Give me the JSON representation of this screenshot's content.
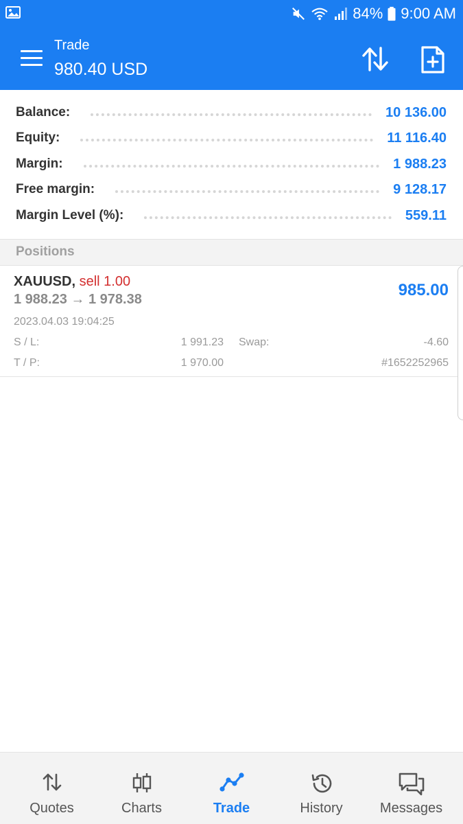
{
  "status_bar": {
    "battery": "84%",
    "time": "9:00 AM"
  },
  "app_bar": {
    "title": "Trade",
    "subtitle": "980.40 USD"
  },
  "summary": {
    "balance_label": "Balance:",
    "balance_value": "10 136.00",
    "equity_label": "Equity:",
    "equity_value": "11 116.40",
    "margin_label": "Margin:",
    "margin_value": "1 988.23",
    "free_margin_label": "Free margin:",
    "free_margin_value": "9 128.17",
    "margin_level_label": "Margin Level (%):",
    "margin_level_value": "559.11"
  },
  "positions": {
    "header": "Positions",
    "items": [
      {
        "symbol": "XAUUSD,",
        "type": "sell 1.00",
        "price_open": "1 988.23",
        "arrow": "→",
        "price_current": "1 978.38",
        "profit": "985.00",
        "time": "2023.04.03 19:04:25",
        "sl_label": "S / L:",
        "sl_value": "1 991.23",
        "swap_label": "Swap:",
        "swap_value": "-4.60",
        "tp_label": "T / P:",
        "tp_value": "1 970.00",
        "ticket": "#1652252965"
      }
    ]
  },
  "nav": {
    "active_color": "#1b7ef2",
    "items": [
      {
        "label": "Quotes",
        "icon": "quotes-icon"
      },
      {
        "label": "Charts",
        "icon": "charts-icon"
      },
      {
        "label": "Trade",
        "icon": "trade-icon"
      },
      {
        "label": "History",
        "icon": "history-icon"
      },
      {
        "label": "Messages",
        "icon": "messages-icon"
      }
    ]
  }
}
